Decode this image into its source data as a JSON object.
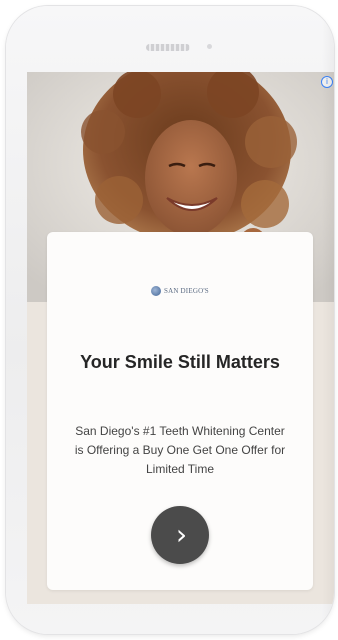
{
  "device": {
    "speaker_icon": "speaker-grille",
    "sensor_icon": "front-camera"
  },
  "ad": {
    "info_icon": "info-icon",
    "info_glyph": "i",
    "accent_color": "#3b82f6"
  },
  "hero": {
    "image": "smiling woman with curly hair"
  },
  "card": {
    "logo_text": "SAN DIEGO'S",
    "headline": "Your Smile Still Matters",
    "body": "San Diego's #1 Teeth Whitening Center is Offering a Buy One Get One Offer for Limited Time",
    "cta_icon": "chevron-right-icon",
    "cta_glyph": "›",
    "cta_color": "#4b4b4b"
  }
}
